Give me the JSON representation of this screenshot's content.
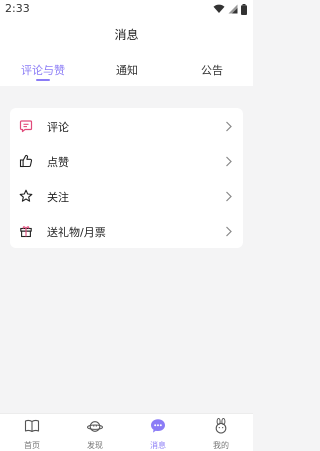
{
  "status_bar": {
    "time": "2:33"
  },
  "header": {
    "title": "消息"
  },
  "tabs": [
    {
      "label": "评论与赞",
      "active": true
    },
    {
      "label": "通知",
      "active": false
    },
    {
      "label": "公告",
      "active": false
    }
  ],
  "menu": {
    "items": [
      {
        "label": "评论",
        "icon": "comment-icon"
      },
      {
        "label": "点赞",
        "icon": "thumbs-up-icon"
      },
      {
        "label": "关注",
        "icon": "star-icon"
      },
      {
        "label": "送礼物/月票",
        "icon": "gift-icon"
      }
    ]
  },
  "bottom_nav": {
    "items": [
      {
        "label": "首页",
        "icon": "book-icon",
        "active": false
      },
      {
        "label": "发现",
        "icon": "planet-icon",
        "active": false
      },
      {
        "label": "消息",
        "icon": "message-icon",
        "active": true
      },
      {
        "label": "我的",
        "icon": "bunny-icon",
        "active": false
      }
    ]
  },
  "colors": {
    "accent": "#8b7cf6",
    "background": "#f4f4f5",
    "card": "#ffffff"
  }
}
